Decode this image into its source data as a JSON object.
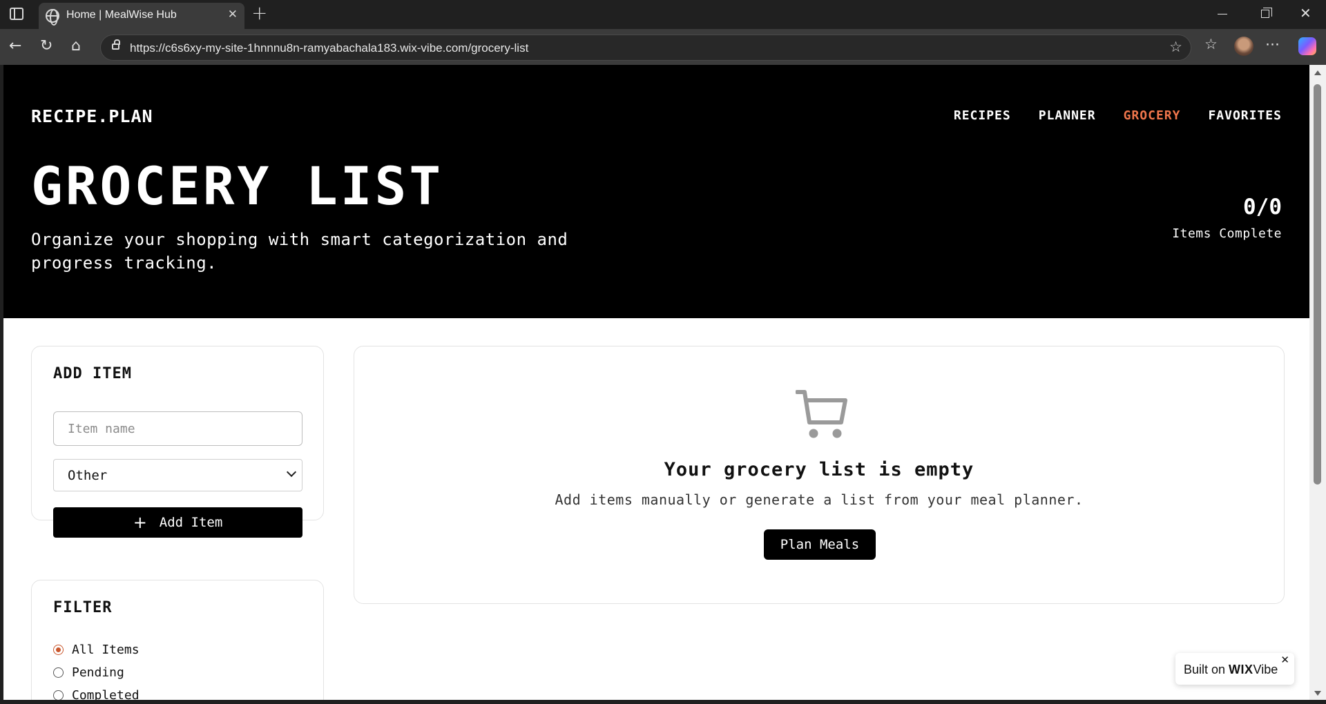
{
  "browser": {
    "tab_title": "Home | MealWise Hub",
    "url": "https://c6s6xy-my-site-1hnnnu8n-ramyabachala183.wix-vibe.com/grocery-list"
  },
  "site": {
    "logo": "RECIPE.PLAN",
    "nav": [
      {
        "label": "RECIPES",
        "active": false
      },
      {
        "label": "PLANNER",
        "active": false
      },
      {
        "label": "GROCERY",
        "active": true
      },
      {
        "label": "FAVORITES",
        "active": false
      }
    ],
    "accent_color": "#f0764c"
  },
  "hero": {
    "title": "GROCERY LIST",
    "subtitle": "Organize your shopping with smart categorization and progress tracking.",
    "counter_value": "0/0",
    "counter_label": "Items Complete"
  },
  "add_item": {
    "title": "ADD ITEM",
    "name_placeholder": "Item name",
    "category_value": "Other",
    "button_label": "Add Item"
  },
  "filter": {
    "title": "FILTER",
    "options": [
      {
        "label": "All Items",
        "checked": true
      },
      {
        "label": "Pending",
        "checked": false
      },
      {
        "label": "Completed",
        "checked": false
      }
    ]
  },
  "empty_state": {
    "icon": "shopping-cart-icon",
    "title": "Your grocery list is empty",
    "message": "Add items manually or generate a list from your meal planner.",
    "button_label": "Plan Meals"
  },
  "badge": {
    "prefix": "Built on ",
    "brand": "WIX",
    "suffix": "Vibe"
  }
}
